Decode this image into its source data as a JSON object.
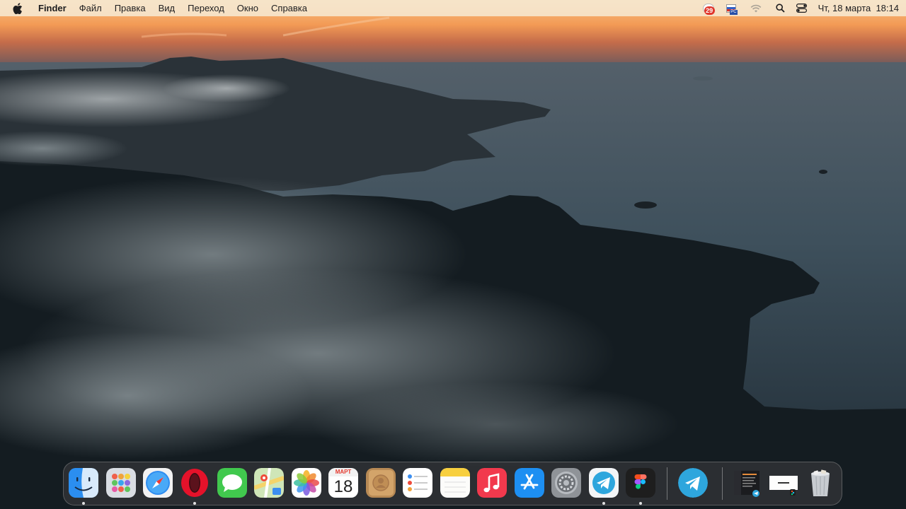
{
  "menubar": {
    "app_name": "Finder",
    "menus": [
      "Файл",
      "Правка",
      "Вид",
      "Переход",
      "Окно",
      "Справка"
    ],
    "status": {
      "notification_count": "29",
      "input_source_label": "PC",
      "clock": "Чт, 18 марта  18:14"
    }
  },
  "dock": {
    "items": [
      {
        "name": "Finder",
        "icon": "finder-icon",
        "running": true
      },
      {
        "name": "Launchpad",
        "icon": "launchpad-icon",
        "running": false
      },
      {
        "name": "Safari",
        "icon": "safari-icon",
        "running": false
      },
      {
        "name": "Opera",
        "icon": "opera-icon",
        "running": true
      },
      {
        "name": "Messages",
        "icon": "messages-icon",
        "running": false
      },
      {
        "name": "Maps",
        "icon": "maps-icon",
        "running": false
      },
      {
        "name": "Photos",
        "icon": "photos-icon",
        "running": false
      },
      {
        "name": "Calendar",
        "icon": "calendar-icon",
        "running": false
      },
      {
        "name": "Contacts",
        "icon": "contacts-icon",
        "running": false
      },
      {
        "name": "Reminders",
        "icon": "reminders-icon",
        "running": false
      },
      {
        "name": "Notes",
        "icon": "notes-icon",
        "running": false
      },
      {
        "name": "Music",
        "icon": "music-icon",
        "running": false
      },
      {
        "name": "App Store",
        "icon": "app-store-icon",
        "running": false
      },
      {
        "name": "System Preferences",
        "icon": "gear-icon",
        "running": false
      },
      {
        "name": "Telegram",
        "icon": "telegram-icon",
        "running": true
      },
      {
        "name": "Figma",
        "icon": "figma-icon",
        "running": true
      },
      {
        "name": "Telegram",
        "icon": "telegram-round-icon",
        "running": false
      },
      {
        "name": "Minimized window",
        "icon": "window-thumbnail-icon",
        "running": false
      },
      {
        "name": "Minimized window",
        "icon": "window-thumbnail-icon",
        "running": false
      },
      {
        "name": "Trash",
        "icon": "trash-icon",
        "running": false
      }
    ],
    "calendar": {
      "month": "МАРТ",
      "day": "18"
    }
  },
  "colors": {
    "menubar_bg": "#f6e8d2",
    "sky_orange": "#f0a05a",
    "sea": "#3b4e5c",
    "dock_bg": "#3a3a3e"
  }
}
